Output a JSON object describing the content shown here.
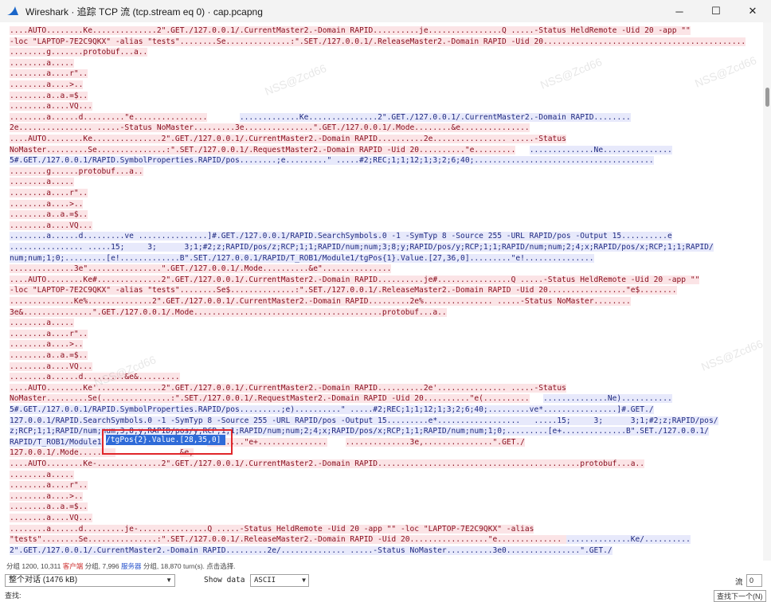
{
  "window": {
    "title": "Wireshark · 追踪 TCP 流 (tcp.stream eq 0) · cap.pcapng",
    "minimize": "─",
    "maximize": "☐",
    "close": "✕"
  },
  "stream_lines": [
    {
      "segs": [
        [
          "c",
          "....AUTO........Ke..............2\".GET./127.0.0.1/.CurrentMaster2.-Domain RAPID..........je................Q .....-Status HeldRemote -Uid 20 -app \"\""
        ]
      ]
    },
    {
      "segs": [
        [
          "c",
          "-loc \"LAPTOP-7E2C9QKX\" -alias \"tests\"........Se..............:\".SET./127.0.0.1/.ReleaseMaster2.-Domain RAPID -Uid 20............................................"
        ]
      ]
    },
    {
      "segs": [
        [
          "c",
          "........g.......protobuf...a.."
        ]
      ]
    },
    {
      "segs": [
        [
          "c",
          "........a....."
        ]
      ]
    },
    {
      "segs": [
        [
          "c",
          "........a....r\".."
        ]
      ]
    },
    {
      "segs": [
        [
          "c",
          "........a....>.."
        ]
      ]
    },
    {
      "segs": [
        [
          "c",
          "........a..a.=$.."
        ]
      ]
    },
    {
      "segs": [
        [
          "c",
          "........a....VQ..."
        ]
      ]
    },
    {
      "segs": [
        [
          "c",
          "........a......d.........\"e................"
        ],
        [
          "w",
          "       "
        ],
        [
          "s",
          ".............Ke...............2\".GET./127.0.0.1/.CurrentMaster2.-Domain RAPID........"
        ]
      ]
    },
    {
      "segs": [
        [
          "c",
          "2e................ .....-Status NoMaster.........3e...............\".GET./127.0.0.1/.Mode........&e..............."
        ]
      ]
    },
    {
      "segs": [
        [
          "c",
          "....AUTO........Ke...............2\".GET./127.0.0.1/.CurrentMaster2.-Domain RAPID..........2e................ .....-Status"
        ]
      ]
    },
    {
      "segs": [
        [
          "c",
          "NoMaster.........Se...............:\".SET./127.0.0.1/.RequestMaster2.-Domain RAPID -Uid 20..........\"e........."
        ],
        [
          "w",
          "   "
        ],
        [
          "s",
          "..............Ne..............."
        ]
      ]
    },
    {
      "segs": [
        [
          "s",
          "5#.GET./127.0.0.1/RAPID.SymbolProperties.RAPID/pos........;e.........\" .....#2;REC;1;1;12;1;3;2;6;40;......................................."
        ]
      ]
    },
    {
      "segs": [
        [
          "c",
          "........g......protobuf...a.."
        ]
      ]
    },
    {
      "segs": [
        [
          "c",
          "........a....."
        ]
      ]
    },
    {
      "segs": [
        [
          "c",
          "........a....r\".."
        ]
      ]
    },
    {
      "segs": [
        [
          "c",
          "........a....>.."
        ]
      ]
    },
    {
      "segs": [
        [
          "c",
          "........a..a.=$.."
        ]
      ]
    },
    {
      "segs": [
        [
          "c",
          "........a....VQ..."
        ]
      ]
    },
    {
      "segs": [
        [
          "s",
          "........a......d.........ve ...............]#.GET./127.0.0.1/RAPID.SearchSymbols.0 -1 -SymTyp 8 -Source 255 -URL RAPID/pos -Output 15..........e"
        ]
      ]
    },
    {
      "segs": [
        [
          "s",
          "................ .....15;     3;      3;1;#2;z;RAPID/pos/z;RCP;1;1;RAPID/num;num;3;8;y;RAPID/pos/y;RCP;1;1;RAPID/num;num;2;4;x;RAPID/pos/x;RCP;1;1;RAPID/"
        ]
      ]
    },
    {
      "segs": [
        [
          "s",
          "num;num;1;0;.........[e!.............B\".SET./127.0.0.1/RAPID/T_ROB1/Module1/tgPos{1}.Value.[27,36,0].........\"e!..............."
        ]
      ]
    },
    {
      "segs": [
        [
          "c",
          "..............3e\"................\".GET./127.0.0.1/.Mode..........&e\"..............."
        ]
      ]
    },
    {
      "segs": [
        [
          "c",
          "....AUTO........Ke#..............2\".GET./127.0.0.1/.CurrentMaster2.-Domain RAPID..........je#................Q .....-Status HeldRemote -Uid 20 -app \"\""
        ]
      ]
    },
    {
      "segs": [
        [
          "c",
          "-loc \"LAPTOP-7E2C9QKX\" -alias \"tests\"........Se$..............:\".SET./127.0.0.1/.ReleaseMaster2.-Domain RAPID -Uid 20.................\"e$........"
        ]
      ]
    },
    {
      "segs": [
        [
          "c",
          "..............Ke%..............2\".GET./127.0.0.1/.CurrentMaster2.-Domain RAPID.........2e%............... .....-Status NoMaster........"
        ]
      ]
    },
    {
      "segs": [
        [
          "c",
          "3e&...............\".GET./127.0.0.1/.Mode.........................................protobuf...a.."
        ]
      ]
    },
    {
      "segs": [
        [
          "c",
          "........a....."
        ]
      ]
    },
    {
      "segs": [
        [
          "c",
          "........a....r\".."
        ]
      ]
    },
    {
      "segs": [
        [
          "c",
          "........a....>.."
        ]
      ]
    },
    {
      "segs": [
        [
          "c",
          "........a..a.=$.."
        ]
      ]
    },
    {
      "segs": [
        [
          "c",
          "........a....VQ..."
        ]
      ]
    },
    {
      "segs": [
        [
          "c",
          "........a......d.........&e&........."
        ]
      ]
    },
    {
      "segs": [
        [
          "c",
          "....AUTO........Ke'..............2\".GET./127.0.0.1/.CurrentMaster2.-Domain RAPID..........2e'............... .....-Status"
        ]
      ]
    },
    {
      "segs": [
        [
          "c",
          "NoMaster.........Se(...............:\".SET./127.0.0.1/.RequestMaster2.-Domain RAPID -Uid 20..........\"e(.........."
        ],
        [
          "w",
          "   "
        ],
        [
          "s",
          "..............Ne)..........."
        ]
      ]
    },
    {
      "segs": [
        [
          "s",
          "5#.GET./127.0.0.1/RAPID.SymbolProperties.RAPID/pos.........;e)..........\" .....#2;REC;1;1;12;1;3;2;6;40;.........ve*................]#.GET./"
        ]
      ]
    },
    {
      "segs": [
        [
          "s",
          "127.0.0.1/RAPID.SearchSymbols.0 -1 -SymTyp 8 -Source 255 -URL RAPID/pos -Output 15.........e*..................   .....15;     3;      3;1;#2;z;RAPID/pos/"
        ]
      ]
    },
    {
      "segs": [
        [
          "s",
          "z;RCP;1;1;RAPID/num;num;3;8;y;RAPID/pos/y;RCP;1;1;RAPID/num;num;2;4;x;RAPID/pos/x;RCP;1;1;RAPID/num;num;1;0;.........[e+..............B\".SET./127.0.0.1/"
        ]
      ]
    },
    {
      "segs": [
        [
          "s",
          "RAPID/T_ROB1/Module1"
        ],
        [
          "w",
          "                       "
        ],
        [
          "c",
          "........\"e+..............."
        ],
        [
          "w",
          "    "
        ],
        [
          "c",
          "..............3e,...............\".GET./"
        ]
      ]
    },
    {
      "segs": [
        [
          "c",
          "127.0.0.1/.Mode........"
        ],
        [
          "w",
          "              "
        ],
        [
          "c",
          "&e,"
        ]
      ]
    },
    {
      "segs": [
        [
          "c",
          "....AUTO........Ke-..............2\".GET./127.0.0.1/.CurrentMaster2.-Domain RAPID............................................protobuf...a.."
        ]
      ]
    },
    {
      "segs": [
        [
          "c",
          "........a....."
        ]
      ]
    },
    {
      "segs": [
        [
          "c",
          "........a....r\".."
        ]
      ]
    },
    {
      "segs": [
        [
          "c",
          "........a....>.."
        ]
      ]
    },
    {
      "segs": [
        [
          "c",
          "........a..a.=$.."
        ]
      ]
    },
    {
      "segs": [
        [
          "c",
          "........a....VQ..."
        ]
      ]
    },
    {
      "segs": [
        [
          "c",
          "........a......d.........je-...............Q .....-Status HeldRemote -Uid 20 -app \"\" -loc \"LAPTOP-7E2C9QKX\" -alias"
        ]
      ]
    },
    {
      "segs": [
        [
          "c",
          "\"tests\"........Se...............:\".SET./127.0.0.1/.ReleaseMaster2.-Domain RAPID -Uid 20.................\"e.............. "
        ],
        [
          "s",
          "..............Ke/.........."
        ]
      ]
    },
    {
      "segs": [
        [
          "s",
          "2\".GET./127.0.0.1/.CurrentMaster2.-Domain RAPID.........2e/.............. .....-Status NoMaster..........3e0................\".GET./"
        ]
      ]
    }
  ],
  "highlight": {
    "text": "/tgPos{2}.Value.[28,35,0]"
  },
  "watermarks": [
    "NSS@Zcd66",
    "NSS@Zcd66",
    "NSS@Zcd66",
    "NSS@Zcd66",
    "NSS@Zcd66"
  ],
  "status": {
    "prefix": "分组 1200, 10,311",
    "client": "客户端",
    "mid": "分组, 7,996",
    "server": "服务器",
    "suffix": "分组, 18,870 turn(s). 点击选择."
  },
  "bottom": {
    "conversation": "整个对话 (1476 kB)",
    "show_data_label": "Show data as",
    "show_data_value": "ASCII",
    "stream_label": "流",
    "stream_value": "0",
    "find_label": "查找:",
    "find_next": "查找下一个(N)"
  },
  "colors": {
    "client_bg": "#fbe4e6",
    "server_bg": "#e7e9fb",
    "highlight_bg": "#2f6bd8",
    "annotation_red": "#e0262a"
  }
}
